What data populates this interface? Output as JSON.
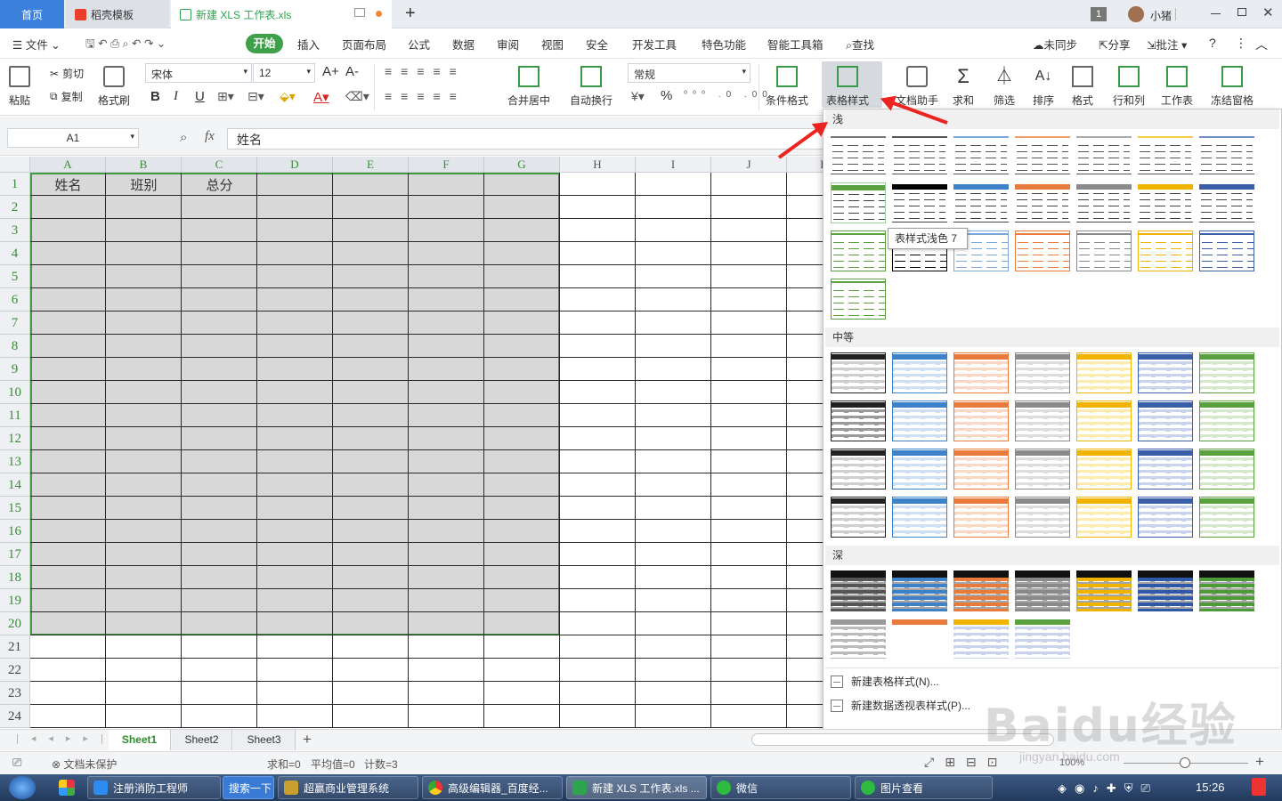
{
  "tabs": {
    "home": "首页",
    "docer": "稻壳模板",
    "file": "新建 XLS 工作表.xls",
    "add": "+"
  },
  "titlebar": {
    "badge": "1",
    "user": "小猪"
  },
  "menu": {
    "file": "文件",
    "start": "开始",
    "insert": "插入",
    "layout": "页面布局",
    "formula": "公式",
    "data": "数据",
    "review": "审阅",
    "view": "视图",
    "security": "安全",
    "dev": "开发工具",
    "special": "特色功能",
    "smart": "智能工具箱",
    "find": "查找",
    "sync": "未同步",
    "share": "分享",
    "comment": "批注"
  },
  "ribbon": {
    "paste": "粘贴",
    "cut": "剪切",
    "copy": "复制",
    "painter": "格式刷",
    "font": "宋体",
    "size": "12",
    "bold": "B",
    "italic": "I",
    "underline": "U",
    "merge": "合并居中",
    "wrap": "自动换行",
    "numfmt": "常规",
    "percent": "%",
    "cond": "条件格式",
    "tablestyle": "表格样式",
    "docassist": "文档助手",
    "sum": "求和",
    "filter": "筛选",
    "sort": "排序",
    "format": "格式",
    "rowcol": "行和列",
    "sheet": "工作表",
    "freeze": "冻结窗格",
    "grow": "A+",
    "shrink": "A-"
  },
  "formulabar": {
    "namebox": "A1",
    "fx": "fx",
    "value": "姓名"
  },
  "columns": [
    "A",
    "B",
    "C",
    "D",
    "E",
    "F",
    "G",
    "H",
    "I",
    "J",
    "K"
  ],
  "rows": [
    "1",
    "2",
    "3",
    "4",
    "5",
    "6",
    "7",
    "8",
    "9",
    "10",
    "11",
    "12",
    "13",
    "14",
    "15",
    "16",
    "17",
    "18",
    "19",
    "20",
    "21",
    "22",
    "23",
    "24"
  ],
  "header_cells": [
    "姓名",
    "班别",
    "总分"
  ],
  "gallery": {
    "light": "浅",
    "medium": "中等",
    "dark": "深",
    "tooltip": "表样式浅色 7",
    "new_table_style": "新建表格样式(N)...",
    "new_pivot_style": "新建数据透视表样式(P)..."
  },
  "swatch_colors": [
    "#555555",
    "#3d82c8",
    "#e87a3c",
    "#8a8a8a",
    "#f0b400",
    "#3a5fa8",
    "#5aa03c"
  ],
  "sheets": [
    "Sheet1",
    "Sheet2",
    "Sheet3"
  ],
  "status": {
    "protect": "文档未保护",
    "sum": "求和=0",
    "avg": "平均值=0",
    "count": "计数=3",
    "zoom": "100%"
  },
  "taskbar": {
    "t1": "注册消防工程师",
    "t2": "搜索一下",
    "t3": "超赢商业管理系统",
    "t4": "高级编辑器_百度经...",
    "t5": "新建 XLS 工作表.xls ...",
    "t6": "微信",
    "t7": "图片查看",
    "clock": "15:26"
  },
  "watermark": {
    "brand": "Baidu经验",
    "url": "jingyan.baidu.com"
  }
}
